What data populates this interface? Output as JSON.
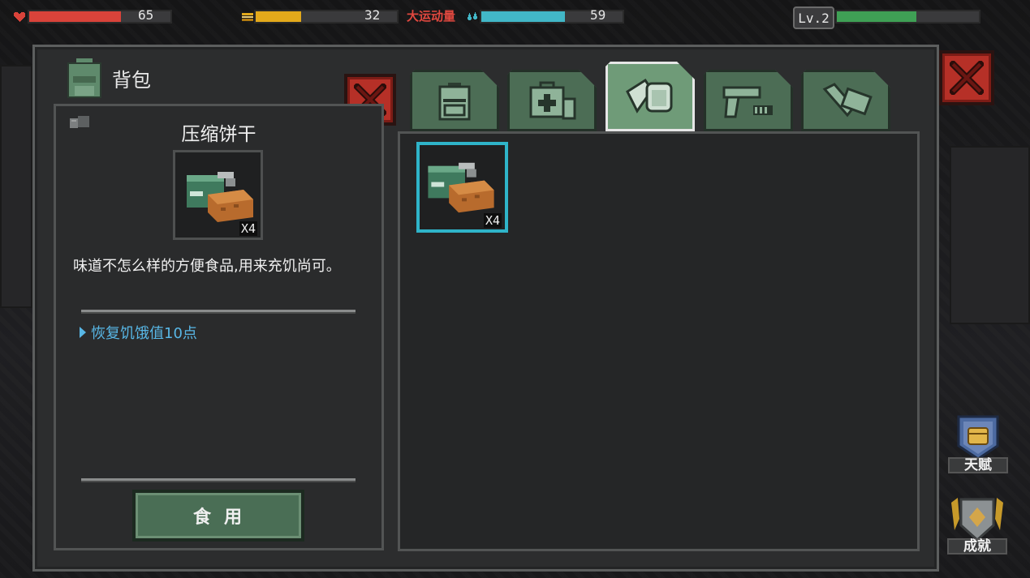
{
  "hud": {
    "health": {
      "value": "65",
      "percent": 65,
      "color": "#d9433a",
      "icon": "heart-icon"
    },
    "hunger": {
      "value": "32",
      "percent": 32,
      "color": "#e3a91b",
      "icon": "food-icon"
    },
    "thirst": {
      "value": "59",
      "percent": 59,
      "color": "#42b7c7",
      "icon": "water-drop-icon"
    },
    "exercise_label": "大运动量",
    "level": {
      "label": "Lv.2",
      "percent": 56,
      "color": "#3fa055"
    }
  },
  "panel": {
    "title": "背包",
    "title_icon": "backpack-icon"
  },
  "detail": {
    "category_icon": "food-category-icon",
    "item_name": "压缩饼干",
    "quantity": "X4",
    "description": "味道不怎么样的方便食品,用来充饥尚可。",
    "effect": "恢复饥饿值10点",
    "action_label": "食用"
  },
  "tabs": [
    {
      "icon": "backpack-icon",
      "active": false
    },
    {
      "icon": "medkit-icon",
      "active": false
    },
    {
      "icon": "food-icon",
      "active": true
    },
    {
      "icon": "gun-icon",
      "active": false
    },
    {
      "icon": "wrench-icon",
      "active": false
    }
  ],
  "grid": {
    "items": [
      {
        "name": "压缩饼干",
        "quantity": "X4",
        "selected": true
      }
    ]
  },
  "side_buttons": {
    "talent_label": "天赋",
    "achievement_label": "成就"
  },
  "colors": {
    "accent_selected": "#2fb4c9",
    "tab_green": "#4c6d55",
    "close_red": "#b63027",
    "effect_blue": "#58b7e6"
  }
}
